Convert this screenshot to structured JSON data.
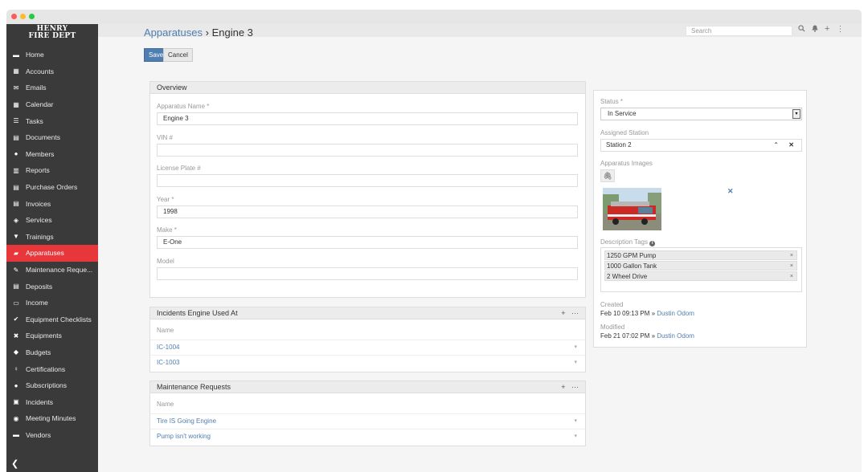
{
  "colors": {
    "accent": "#4f7fb0",
    "sidebar": "#3a3a3a",
    "active": "#e8373b"
  },
  "sidebar": {
    "logo_line1": "HENRY",
    "logo_line2": "FIRE DEPT",
    "items": [
      {
        "label": "Home",
        "icon": "home-icon"
      },
      {
        "label": "Accounts",
        "icon": "building-icon"
      },
      {
        "label": "Emails",
        "icon": "envelope-icon"
      },
      {
        "label": "Calendar",
        "icon": "calendar-icon"
      },
      {
        "label": "Tasks",
        "icon": "tasks-icon"
      },
      {
        "label": "Documents",
        "icon": "document-icon"
      },
      {
        "label": "Members",
        "icon": "user-icon"
      },
      {
        "label": "Reports",
        "icon": "chart-icon"
      },
      {
        "label": "Purchase Orders",
        "icon": "order-icon"
      },
      {
        "label": "Invoices",
        "icon": "invoice-icon"
      },
      {
        "label": "Services",
        "icon": "services-icon"
      },
      {
        "label": "Trainings",
        "icon": "trainings-icon"
      },
      {
        "label": "Apparatuses",
        "icon": "truck-icon"
      },
      {
        "label": "Maintenance Reque...",
        "icon": "wrench-icon"
      },
      {
        "label": "Deposits",
        "icon": "deposit-icon"
      },
      {
        "label": "Income",
        "icon": "money-icon"
      },
      {
        "label": "Equipment Checklists",
        "icon": "check-icon"
      },
      {
        "label": "Equipments",
        "icon": "tools-icon"
      },
      {
        "label": "Budgets",
        "icon": "budget-icon"
      },
      {
        "label": "Certifications",
        "icon": "certificate-icon"
      },
      {
        "label": "Subscriptions",
        "icon": "subscription-icon"
      },
      {
        "label": "Incidents",
        "icon": "incident-icon"
      },
      {
        "label": "Meeting Minutes",
        "icon": "meeting-icon"
      },
      {
        "label": "Vendors",
        "icon": "vendor-icon"
      }
    ],
    "active_index": 12,
    "collapse_glyph": "❮"
  },
  "topbar": {
    "search_placeholder": "Search"
  },
  "page": {
    "breadcrumb": "Apparatuses",
    "separator": "›",
    "title": "Engine 3"
  },
  "actions": {
    "save": "Save",
    "cancel": "Cancel"
  },
  "overview": {
    "heading": "Overview",
    "fields": [
      {
        "label": "Apparatus Name *",
        "value": "Engine 3"
      },
      {
        "label": "VIN #",
        "value": ""
      },
      {
        "label": "License Plate #",
        "value": ""
      },
      {
        "label": "Year *",
        "value": "1998"
      },
      {
        "label": "Make *",
        "value": "E-One"
      },
      {
        "label": "Model",
        "value": ""
      }
    ]
  },
  "incidents": {
    "heading": "Incidents Engine Used At",
    "column": "Name",
    "rows": [
      "IC-1004",
      "IC-1003"
    ]
  },
  "maintenance": {
    "heading": "Maintenance Requests",
    "column": "Name",
    "rows": [
      "Tire IS Going Engine",
      "Pump isn't working"
    ]
  },
  "details": {
    "status_label": "Status *",
    "status_value": "In Service",
    "station_label": "Assigned Station",
    "station_value": "Station 2",
    "images_label": "Apparatus Images",
    "tags_label": "Description Tags",
    "tags": [
      "1250 GPM Pump",
      "1000 Gallon Tank",
      "2 Wheel Drive"
    ],
    "created_label": "Created",
    "created_value": "Feb 10 09:13 PM »",
    "created_by": "Dustin Odom",
    "modified_label": "Modified",
    "modified_value": "Feb 21 07:02 PM »",
    "modified_by": "Dustin Odom"
  }
}
